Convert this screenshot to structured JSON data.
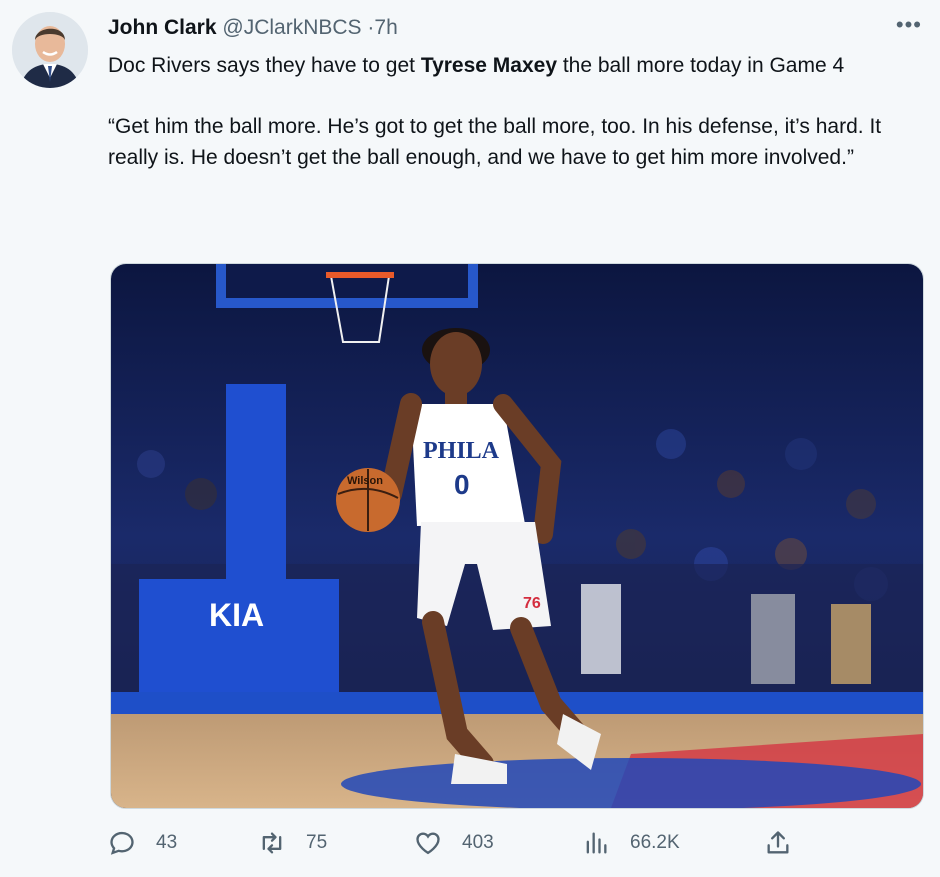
{
  "tweet": {
    "author_name": "John Clark",
    "handle": "@JClarkNBCS",
    "time": "7h",
    "text_before": "Doc Rivers says they have to get ",
    "text_bold": "Tyrese Maxey",
    "text_after": " the ball more today in Game 4",
    "quote": "“Get him the ball more. He’s got to get the ball more, too. In his defense, it’s hard. It really is. He doesn’t get the ball enough, and we have to get him more involved.”",
    "more_icon": "more-horizontal-icon"
  },
  "media": {
    "jersey_word": "PHILA",
    "jersey_number": "0",
    "shorts_logo": "76",
    "sponsor": "KIA",
    "ball_brand": "Wilson"
  },
  "actions": {
    "replies": "43",
    "retweets": "75",
    "likes": "403",
    "views": "66.2K"
  },
  "colors": {
    "text": "#0f1419",
    "secondary": "#536471",
    "court_blue": "#1e4fc8",
    "sixers_red": "#d42d3f"
  }
}
